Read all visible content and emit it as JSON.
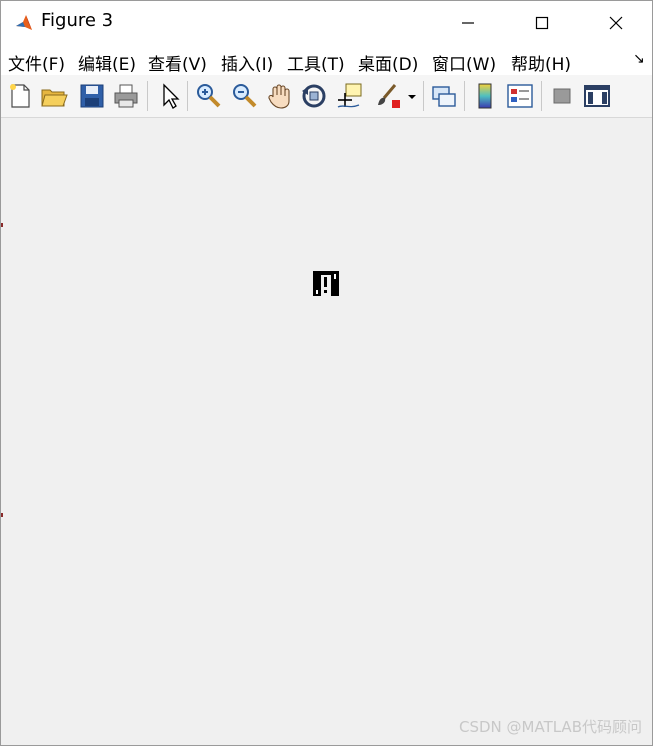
{
  "window": {
    "title": "Figure 3"
  },
  "menubar": {
    "items": [
      "文件(F)",
      "编辑(E)",
      "查看(V)",
      "插入(I)",
      "工具(T)",
      "桌面(D)",
      "窗口(W)",
      "帮助(H)"
    ]
  },
  "toolbar": {
    "icons": [
      "new-figure-icon",
      "open-file-icon",
      "save-icon",
      "print-icon",
      "edit-plot-icon",
      "zoom-in-icon",
      "zoom-out-icon",
      "pan-icon",
      "rotate-3d-icon",
      "data-cursor-icon",
      "brush-icon",
      "brush-dropdown-icon",
      "link-plot-icon",
      "insert-colorbar-icon",
      "insert-legend-icon",
      "hide-plot-tools-icon",
      "show-plot-tools-icon"
    ]
  },
  "watermark": {
    "text": "CSDN @MATLAB代码顾问"
  },
  "colors": {
    "titlebar": "#ffffff",
    "figure_background": "#f0f0f0",
    "brush_red": "#e02020"
  }
}
